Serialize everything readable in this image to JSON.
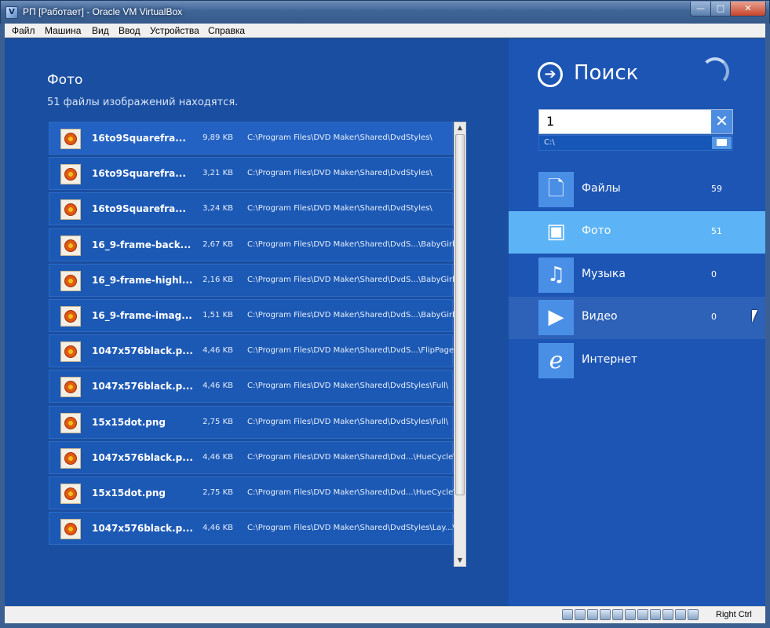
{
  "window": {
    "title": "РП [Работает] - Oracle VM VirtualBox",
    "min_glyph": "—",
    "max_glyph": "□",
    "close_glyph": "✕"
  },
  "menu": [
    "Файл",
    "Машина",
    "Вид",
    "Ввод",
    "Устройства",
    "Справка"
  ],
  "main": {
    "title": "Фото",
    "subtitle": "51 файлы изображений находятся.",
    "files": [
      {
        "name": "16to9Squarefra...",
        "size": "9,89 KB",
        "path": "C:\\Program Files\\DVD Maker\\Shared\\DvdStyles\\"
      },
      {
        "name": "16to9Squarefra...",
        "size": "3,21 KB",
        "path": "C:\\Program Files\\DVD Maker\\Shared\\DvdStyles\\"
      },
      {
        "name": "16to9Squarefra...",
        "size": "3,24 KB",
        "path": "C:\\Program Files\\DVD Maker\\Shared\\DvdStyles\\"
      },
      {
        "name": "16_9-frame-back...",
        "size": "2,67 KB",
        "path": "C:\\Program Files\\DVD Maker\\Shared\\DvdS...\\BabyGirl\\"
      },
      {
        "name": "16_9-frame-highl...",
        "size": "2,16 KB",
        "path": "C:\\Program Files\\DVD Maker\\Shared\\DvdS...\\BabyGirl\\"
      },
      {
        "name": "16_9-frame-imag...",
        "size": "1,51 KB",
        "path": "C:\\Program Files\\DVD Maker\\Shared\\DvdS...\\BabyGirl\\"
      },
      {
        "name": "1047x576black.p...",
        "size": "4,46 KB",
        "path": "C:\\Program Files\\DVD Maker\\Shared\\DvdS...\\FlipPage\\"
      },
      {
        "name": "1047x576black.p...",
        "size": "4,46 KB",
        "path": "C:\\Program Files\\DVD Maker\\Shared\\DvdStyles\\Full\\"
      },
      {
        "name": "15x15dot.png",
        "size": "2,75 KB",
        "path": "C:\\Program Files\\DVD Maker\\Shared\\DvdStyles\\Full\\"
      },
      {
        "name": "1047x576black.p...",
        "size": "4,46 KB",
        "path": "C:\\Program Files\\DVD Maker\\Shared\\Dvd...\\HueCycle\\"
      },
      {
        "name": "15x15dot.png",
        "size": "2,75 KB",
        "path": "C:\\Program Files\\DVD Maker\\Shared\\Dvd...\\HueCycle\\"
      },
      {
        "name": "1047x576black.p...",
        "size": "4,46 KB",
        "path": "C:\\Program Files\\DVD Maker\\Shared\\DvdStyles\\Lay...\\"
      }
    ]
  },
  "sidebar": {
    "title": "Поиск",
    "arrow_glyph": "➔",
    "search_value": "1",
    "clear_glyph": "✕",
    "search_path": "C:\\",
    "categories": [
      {
        "label": "Файлы",
        "count": "59",
        "icon": "document-icon",
        "glyph": "🗋"
      },
      {
        "label": "Фото",
        "count": "51",
        "icon": "photo-icon",
        "glyph": "▣"
      },
      {
        "label": "Музыка",
        "count": "0",
        "icon": "music-icon",
        "glyph": "♫"
      },
      {
        "label": "Видео",
        "count": "0",
        "icon": "video-icon",
        "glyph": "▶"
      },
      {
        "label": "Интернет",
        "count": "",
        "icon": "internet-explorer-icon",
        "glyph": "e"
      }
    ]
  },
  "statusbar": {
    "host_key": "Right Ctrl"
  },
  "colors": {
    "main_bg": "#1a4ea0",
    "sidebar_bg": "#1d55b4",
    "selected_category": "#5cb3f5",
    "hovered_category": "#2e62b8",
    "icon_tile": "#4a8fe6"
  }
}
